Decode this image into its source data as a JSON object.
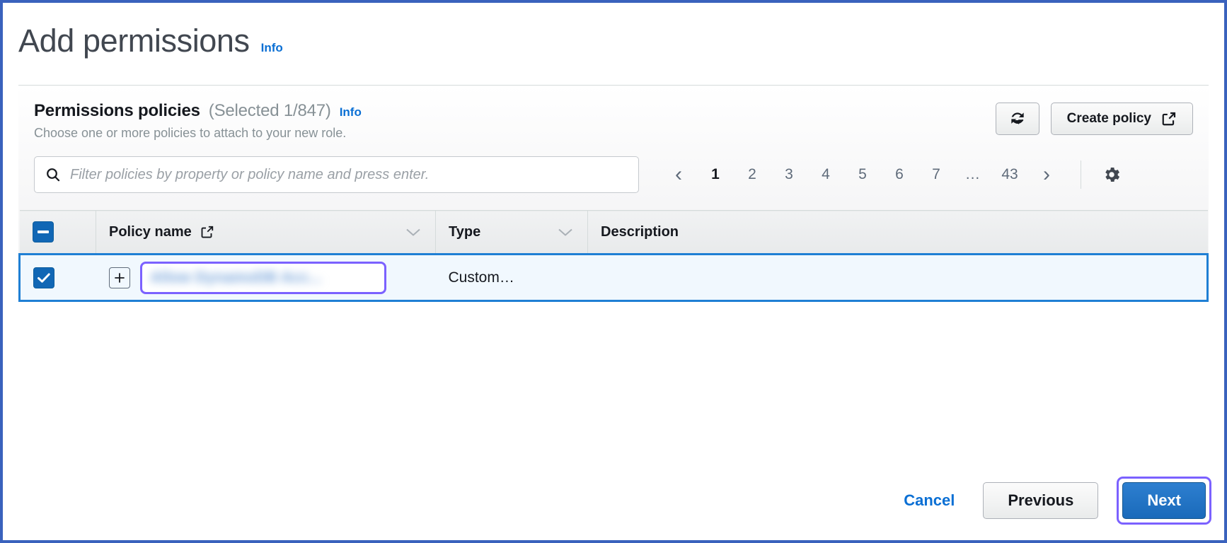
{
  "page": {
    "title": "Add permissions",
    "info_label": "Info"
  },
  "panel": {
    "title": "Permissions policies",
    "count_label": "(Selected 1/847)",
    "info_label": "Info",
    "subtitle": "Choose one or more policies to attach to your new role.",
    "refresh_icon": "refresh-icon",
    "create_policy_label": "Create policy",
    "external_link_icon": "external-link-icon"
  },
  "search": {
    "icon": "search-icon",
    "placeholder": "Filter policies by property or policy name and press enter.",
    "value": ""
  },
  "pagination": {
    "prev_icon": "chevron-left-icon",
    "next_icon": "chevron-right-icon",
    "pages": [
      "1",
      "2",
      "3",
      "4",
      "5",
      "6",
      "7",
      "...",
      "43"
    ],
    "current_page": "1",
    "settings_icon": "gear-icon"
  },
  "table": {
    "select_all_state": "indeterminate",
    "columns": [
      {
        "label": "Policy name",
        "external_link_icon": "external-link-icon",
        "sort_icon": "sort-descending-icon"
      },
      {
        "label": "Type",
        "sort_icon": "sort-descending-icon"
      },
      {
        "label": "Description"
      }
    ],
    "rows": [
      {
        "selected": true,
        "expand_icon": "expand-plus-icon",
        "policy_name": "Allow DynamoDB Acc...",
        "policy_name_redacted": true,
        "type": "Custom…",
        "description": ""
      }
    ]
  },
  "footer": {
    "cancel_label": "Cancel",
    "previous_label": "Previous",
    "next_label": "Next"
  },
  "colors": {
    "accent_blue": "#0a6fd4",
    "primary_button": "#1a6aba",
    "focus_ring_purple": "#7b61ff",
    "selected_row_border": "#1f7fd4",
    "selected_row_bg": "#f1f8fe",
    "outer_border": "#3a62bd"
  }
}
